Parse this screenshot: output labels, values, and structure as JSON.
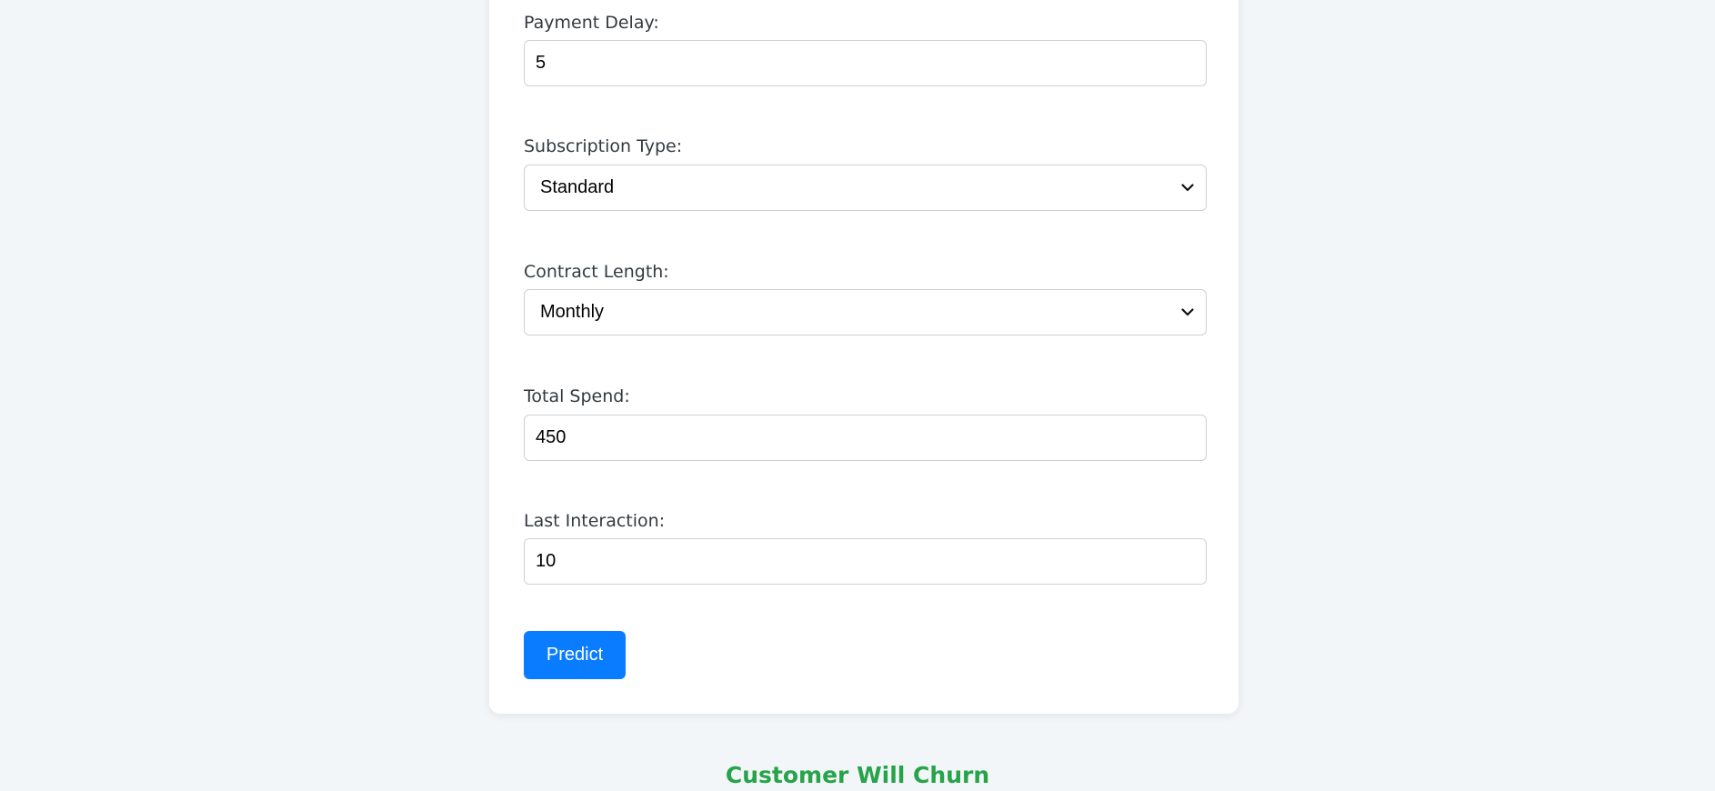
{
  "form": {
    "payment_delay": {
      "label": "Payment Delay:",
      "value": "5"
    },
    "subscription_type": {
      "label": "Subscription Type:",
      "selected": "Standard"
    },
    "contract_length": {
      "label": "Contract Length:",
      "selected": "Monthly"
    },
    "total_spend": {
      "label": "Total Spend:",
      "value": "450"
    },
    "last_interaction": {
      "label": "Last Interaction:",
      "value": "10"
    }
  },
  "predict_button": {
    "label": "Predict"
  },
  "result": {
    "text": "Customer Will Churn",
    "color": "#27a34a"
  },
  "colors": {
    "accent": "#0a7cff",
    "background": "#f3f6f9",
    "card": "#ffffff"
  },
  "icons": {
    "select_indicator": "chevron-down-icon"
  }
}
